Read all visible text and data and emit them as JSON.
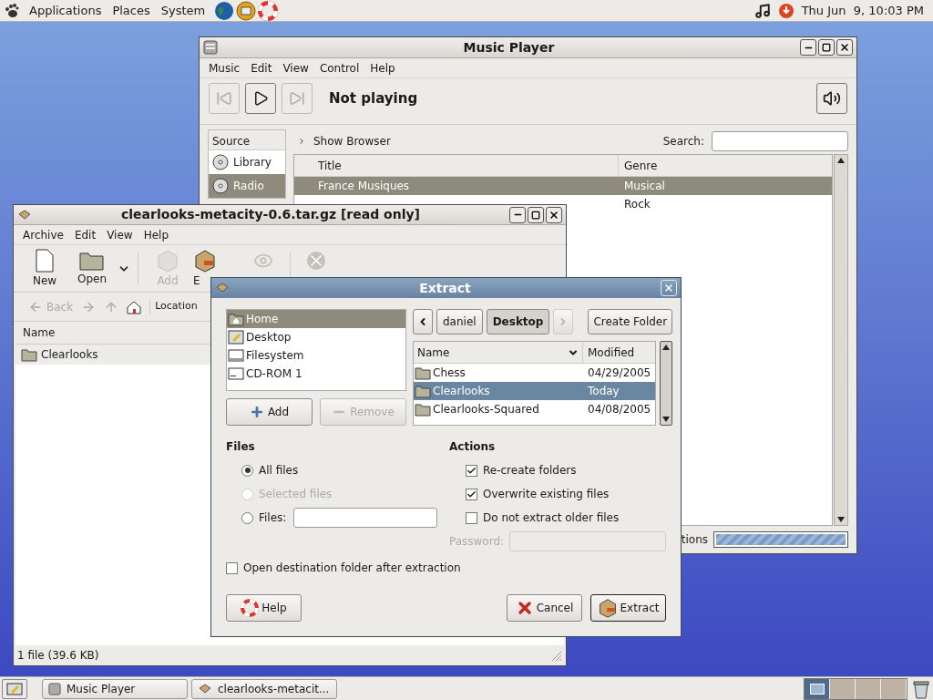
{
  "top_panel": {
    "menus": [
      "Applications",
      "Places",
      "System"
    ],
    "clock": "Thu Jun  9, 10:03 PM"
  },
  "music_player": {
    "title": "Music Player",
    "menu": [
      "Music",
      "Edit",
      "View",
      "Control",
      "Help"
    ],
    "status": "Not playing",
    "source_header": "Source",
    "sources": [
      {
        "label": "Library",
        "selected": false
      },
      {
        "label": "Radio",
        "selected": true
      }
    ],
    "show_browser": "Show Browser",
    "search_label": "Search:",
    "columns": [
      "Title",
      "Genre"
    ],
    "rows": [
      {
        "title": "France Musiques",
        "genre": "Musical",
        "selected": true
      },
      {
        "genre": "Rock",
        "selected": false
      }
    ],
    "footer_text": "tions",
    "progress": {
      "level": 1
    }
  },
  "archive": {
    "title": "clearlooks-metacity-0.6.tar.gz [read only]",
    "menu": [
      "Archive",
      "Edit",
      "View",
      "Help"
    ],
    "toolbar": [
      {
        "kind": "new",
        "label": "New",
        "disabled": false
      },
      {
        "kind": "open",
        "label": "Open",
        "disabled": false
      },
      {
        "kind": "add",
        "label": "Add",
        "disabled": true
      },
      {
        "kind": "extract",
        "label": "E",
        "disabled": false
      }
    ],
    "back": {
      "label": "Back",
      "disabled": true
    },
    "location_label": "Location",
    "column": "Name",
    "rows": [
      {
        "name": "Clearlooks"
      }
    ],
    "status": "1 file (39.6 KB)"
  },
  "extract": {
    "title": "Extract",
    "places": [
      {
        "kind": "home",
        "label": "Home",
        "selected": true
      },
      {
        "kind": "desktop",
        "label": "Desktop",
        "selected": false
      },
      {
        "kind": "filesystem",
        "label": "Filesystem",
        "selected": false
      },
      {
        "kind": "cdrom",
        "label": "CD-ROM 1",
        "selected": false
      }
    ],
    "add": {
      "label": "Add",
      "disabled": false
    },
    "remove": {
      "label": "Remove",
      "disabled": true
    },
    "path": [
      {
        "label": "daniel",
        "selected": false
      },
      {
        "label": "Desktop",
        "selected": true
      }
    ],
    "create_folder": "Create Folder",
    "columns": [
      "Name",
      "Modified"
    ],
    "files": [
      {
        "name": "Chess",
        "modified": "04/29/2005",
        "selected": false
      },
      {
        "name": "Clearlooks",
        "modified": "Today",
        "selected": true
      },
      {
        "name": "Clearlooks-Squared",
        "modified": "04/08/2005",
        "selected": false
      }
    ],
    "files_title": "Files",
    "radios": [
      {
        "kind": "plain",
        "label": "All files",
        "selected": true,
        "disabled": false
      },
      {
        "kind": "plain",
        "label": "Selected files",
        "selected": false,
        "disabled": true
      },
      {
        "kind": "entry",
        "label": "Files:",
        "selected": false,
        "disabled": false
      }
    ],
    "actions_title": "Actions",
    "checks": [
      {
        "label": "Re-create folders",
        "checked": true
      },
      {
        "label": "Overwrite existing files",
        "checked": true
      },
      {
        "label": "Do not extract older files",
        "checked": false
      }
    ],
    "password": {
      "label": "Password:",
      "disabled": true
    },
    "open_after": {
      "label": "Open destination folder after extraction",
      "checked": false
    },
    "buttons": [
      {
        "kind": "help",
        "label": "Help",
        "default": false
      },
      {
        "kind": "cancel",
        "label": "Cancel",
        "default": false
      },
      {
        "kind": "extract",
        "label": "Extract",
        "default": true
      }
    ]
  },
  "taskbar": {
    "tasks": [
      {
        "kind": "music",
        "label": "Music Player"
      },
      {
        "kind": "archive",
        "label": "clearlooks-metacit..."
      }
    ],
    "workspaces": [
      {
        "selected": true
      },
      {
        "selected": false
      },
      {
        "selected": false
      },
      {
        "selected": false
      }
    ]
  }
}
